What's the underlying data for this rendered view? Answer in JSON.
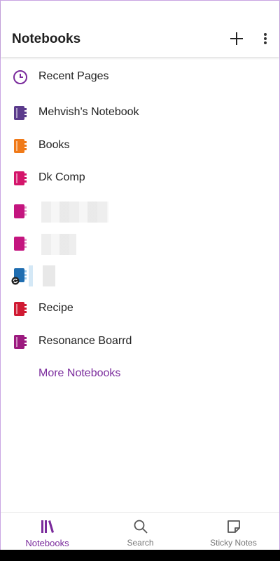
{
  "header": {
    "title": "Notebooks",
    "add_icon": "plus-icon",
    "more_icon": "more-vertical-icon"
  },
  "colors": {
    "accent": "#7a2b9c",
    "purple": "#5b3b8c",
    "orange": "#f07a19",
    "pink": "#d4156b",
    "magenta": "#c4157f",
    "blue": "#1f6db0",
    "red": "#d01a33",
    "plum": "#9c1a7f"
  },
  "list": {
    "recent": {
      "label": "Recent Pages",
      "icon": "clock-icon"
    },
    "notebooks": [
      {
        "label": "Mehvish's Notebook",
        "color": "#5b3b8c",
        "icon": "notebook-icon"
      },
      {
        "label": "Books",
        "color": "#f07a19",
        "icon": "notebook-icon"
      },
      {
        "label": "Dk Comp",
        "color": "#d4156b",
        "icon": "notebook-icon"
      },
      {
        "label": "",
        "color": "#c4157f",
        "icon": "notebook-icon",
        "redacted": true
      },
      {
        "label": "",
        "color": "#c4157f",
        "icon": "notebook-icon",
        "redacted": true
      },
      {
        "label": "",
        "color": "#1f6db0",
        "icon": "notebook-icon",
        "redacted": true,
        "sync": true
      },
      {
        "label": "Recipe",
        "color": "#d01a33",
        "icon": "notebook-icon"
      },
      {
        "label": "Resonance Boarrd",
        "color": "#9c1a7f",
        "icon": "notebook-icon"
      }
    ],
    "more_link": "More Notebooks"
  },
  "bottom_nav": {
    "tabs": [
      {
        "label": "Notebooks",
        "icon": "library-icon",
        "active": true
      },
      {
        "label": "Search",
        "icon": "search-icon",
        "active": false
      },
      {
        "label": "Sticky Notes",
        "icon": "sticky-note-icon",
        "active": false
      }
    ]
  }
}
